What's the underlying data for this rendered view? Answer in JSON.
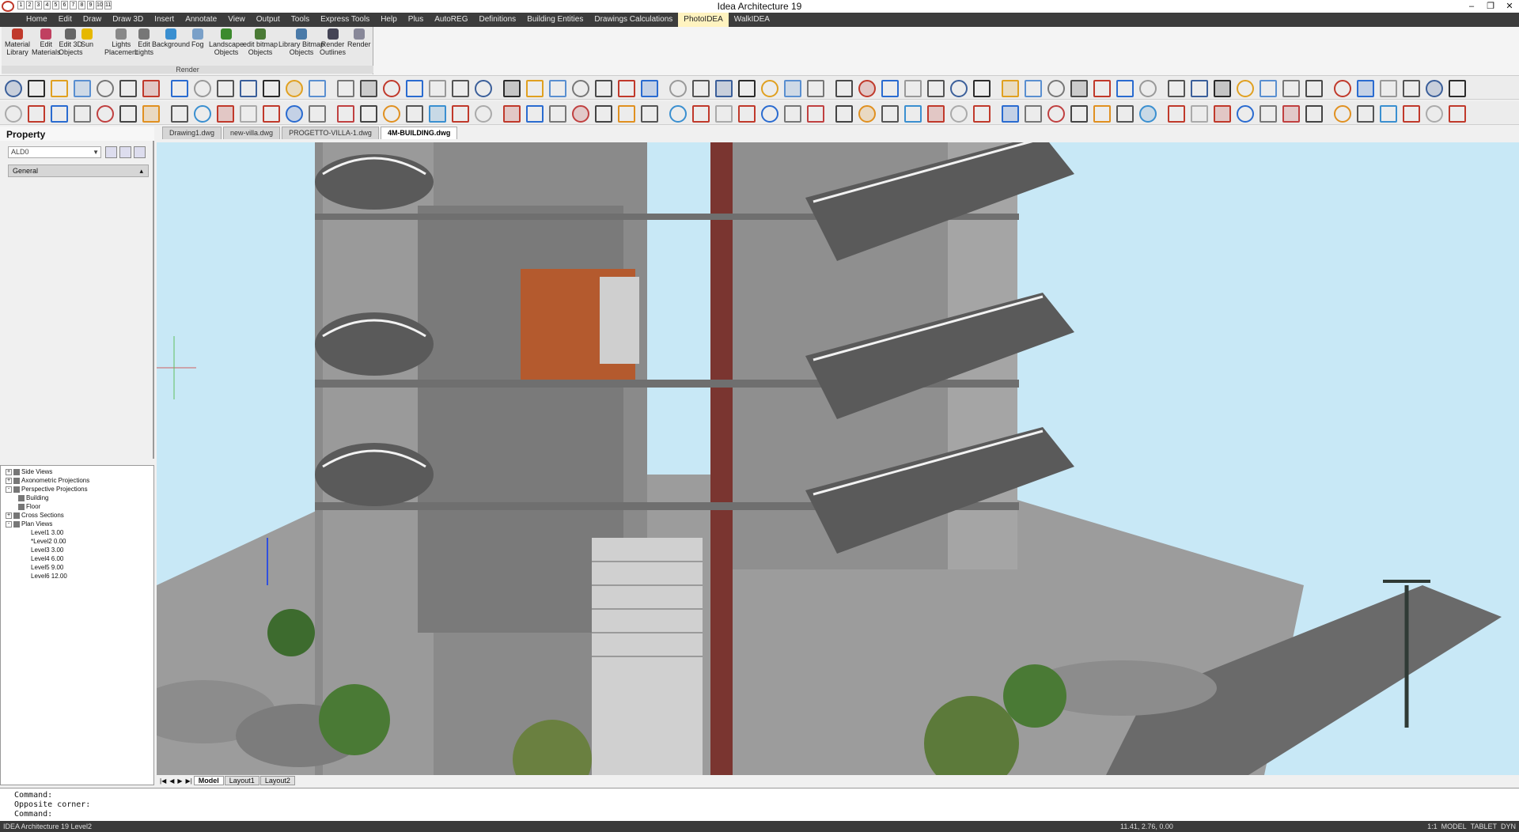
{
  "window": {
    "title": "Idea Architecture 19",
    "controls": [
      "–",
      "❐",
      "✕"
    ]
  },
  "quick_access": [
    "1",
    "2",
    "3",
    "4",
    "5",
    "6",
    "7",
    "8",
    "9",
    "10",
    "11"
  ],
  "menu": [
    {
      "label": "Home"
    },
    {
      "label": "Edit"
    },
    {
      "label": "Draw"
    },
    {
      "label": "Draw 3D"
    },
    {
      "label": "Insert"
    },
    {
      "label": "Annotate"
    },
    {
      "label": "View"
    },
    {
      "label": "Output"
    },
    {
      "label": "Tools"
    },
    {
      "label": "Express Tools"
    },
    {
      "label": "Help"
    },
    {
      "label": "Plus"
    },
    {
      "label": "AutoREG"
    },
    {
      "label": "Definitions"
    },
    {
      "label": "Building Entities"
    },
    {
      "label": "Drawings Calculations"
    },
    {
      "label": "PhotoIDEA",
      "active": true
    },
    {
      "label": "WalkIDEA"
    }
  ],
  "ribbon": {
    "group_label": "Render",
    "buttons": [
      {
        "l1": "Material",
        "l2": "Library",
        "icon": "material-library-icon"
      },
      {
        "l1": "Edit",
        "l2": "Materials",
        "icon": "edit-materials-icon"
      },
      {
        "l1": "Edit 3D",
        "l2": "Objects",
        "icon": "edit-3d-objects-icon"
      },
      {
        "l1": "Sun",
        "l2": "",
        "icon": "sun-icon"
      },
      {
        "l1": "Lights",
        "l2": "Placement",
        "icon": "lights-placement-icon"
      },
      {
        "l1": "Edit",
        "l2": "Lights",
        "icon": "edit-lights-icon"
      },
      {
        "l1": "Background",
        "l2": "",
        "icon": "background-icon"
      },
      {
        "l1": "Fog",
        "l2": "",
        "icon": "fog-icon"
      },
      {
        "l1": "Landscape",
        "l2": "Objects",
        "icon": "landscape-objects-icon"
      },
      {
        "l1": "edit bitmap",
        "l2": "Objects",
        "icon": "edit-bitmap-objects-icon"
      },
      {
        "l1": "Library Bitmap",
        "l2": "Objects",
        "icon": "library-bitmap-objects-icon"
      },
      {
        "l1": "Render",
        "l2": "Outlines",
        "icon": "render-outlines-icon"
      },
      {
        "l1": "Render",
        "l2": "",
        "icon": "render-icon"
      }
    ]
  },
  "property_panel": {
    "title": "Property",
    "layer_value": "ALD0",
    "section_label": "General"
  },
  "tree": [
    {
      "label": "Side Views",
      "indent": 0,
      "expander": "+"
    },
    {
      "label": "Axonometric Projections",
      "indent": 0,
      "expander": "+"
    },
    {
      "label": "Perspective Projections",
      "indent": 0,
      "expander": "-"
    },
    {
      "label": "Building",
      "indent": 1,
      "expander": ""
    },
    {
      "label": "Floor",
      "indent": 1,
      "expander": ""
    },
    {
      "label": "Cross Sections",
      "indent": 0,
      "expander": "+"
    },
    {
      "label": "Plan Views",
      "indent": 0,
      "expander": "-"
    },
    {
      "label": "Level1  3.00",
      "indent": 2,
      "expander": ""
    },
    {
      "label": "*Level2  0.00",
      "indent": 2,
      "expander": ""
    },
    {
      "label": "Level3  3.00",
      "indent": 2,
      "expander": ""
    },
    {
      "label": "Level4  6.00",
      "indent": 2,
      "expander": ""
    },
    {
      "label": "Level5  9.00",
      "indent": 2,
      "expander": ""
    },
    {
      "label": "Level6  12.00",
      "indent": 2,
      "expander": ""
    }
  ],
  "doc_tabs": [
    {
      "label": "Drawing1.dwg"
    },
    {
      "label": "new-villa.dwg"
    },
    {
      "label": "PROGETTO-VILLA-1.dwg"
    },
    {
      "label": "4M-BUILDING.dwg",
      "active": true
    }
  ],
  "layout_tabs": [
    {
      "label": "Model",
      "active": true
    },
    {
      "label": "Layout1"
    },
    {
      "label": "Layout2"
    }
  ],
  "command_lines": [
    "Command:",
    "Opposite corner:",
    "Command:"
  ],
  "status": {
    "left": "IDEA Architecture 19 Level2",
    "coords": "11.41, 2.76, 0.00",
    "right_items": [
      "1:1",
      "MODEL",
      "TABLET",
      "DYN"
    ]
  },
  "colors": {
    "menubar": "#3c3c3c",
    "active_menu": "#fff3c0",
    "sky": "#c8e8f6",
    "building": "#8c8c8c",
    "brick": "#7a3530"
  }
}
